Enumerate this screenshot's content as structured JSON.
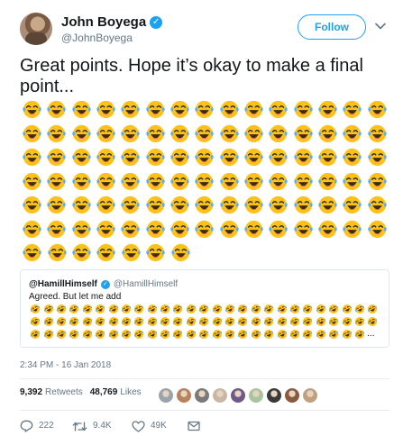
{
  "author": {
    "display_name": "John Boyega",
    "handle": "@JohnBoyega",
    "verified": true
  },
  "follow_button": {
    "label": "Follow"
  },
  "tweet": {
    "text": "Great points. Hope it’s okay to make a final point...",
    "emoji_name": "face-with-tears-of-joy",
    "emoji_rows": [
      15,
      15,
      15,
      15,
      15,
      15,
      7
    ]
  },
  "quoted_tweet": {
    "display_name": "@HamillHimself",
    "handle": "@HamillHimself",
    "verified": true,
    "text": "Agreed. But let me add",
    "emoji_name": "rolling-on-the-floor-laughing",
    "emoji_rows": [
      27,
      27,
      26
    ],
    "truncation": "..."
  },
  "timestamp": "2:34 PM - 16 Jan 2018",
  "stats": {
    "retweets_count": "9,392",
    "retweets_label": "Retweets",
    "likes_count": "48,769",
    "likes_label": "Likes"
  },
  "likers_count": 9,
  "actions": {
    "reply_count": "222",
    "retweet_count": "9.4K",
    "like_count": "49K"
  },
  "colors": {
    "accent": "#1da1f2",
    "secondary_text": "#657786",
    "emoji_face": "#fcc21b",
    "emoji_tears": "#5dadec"
  }
}
